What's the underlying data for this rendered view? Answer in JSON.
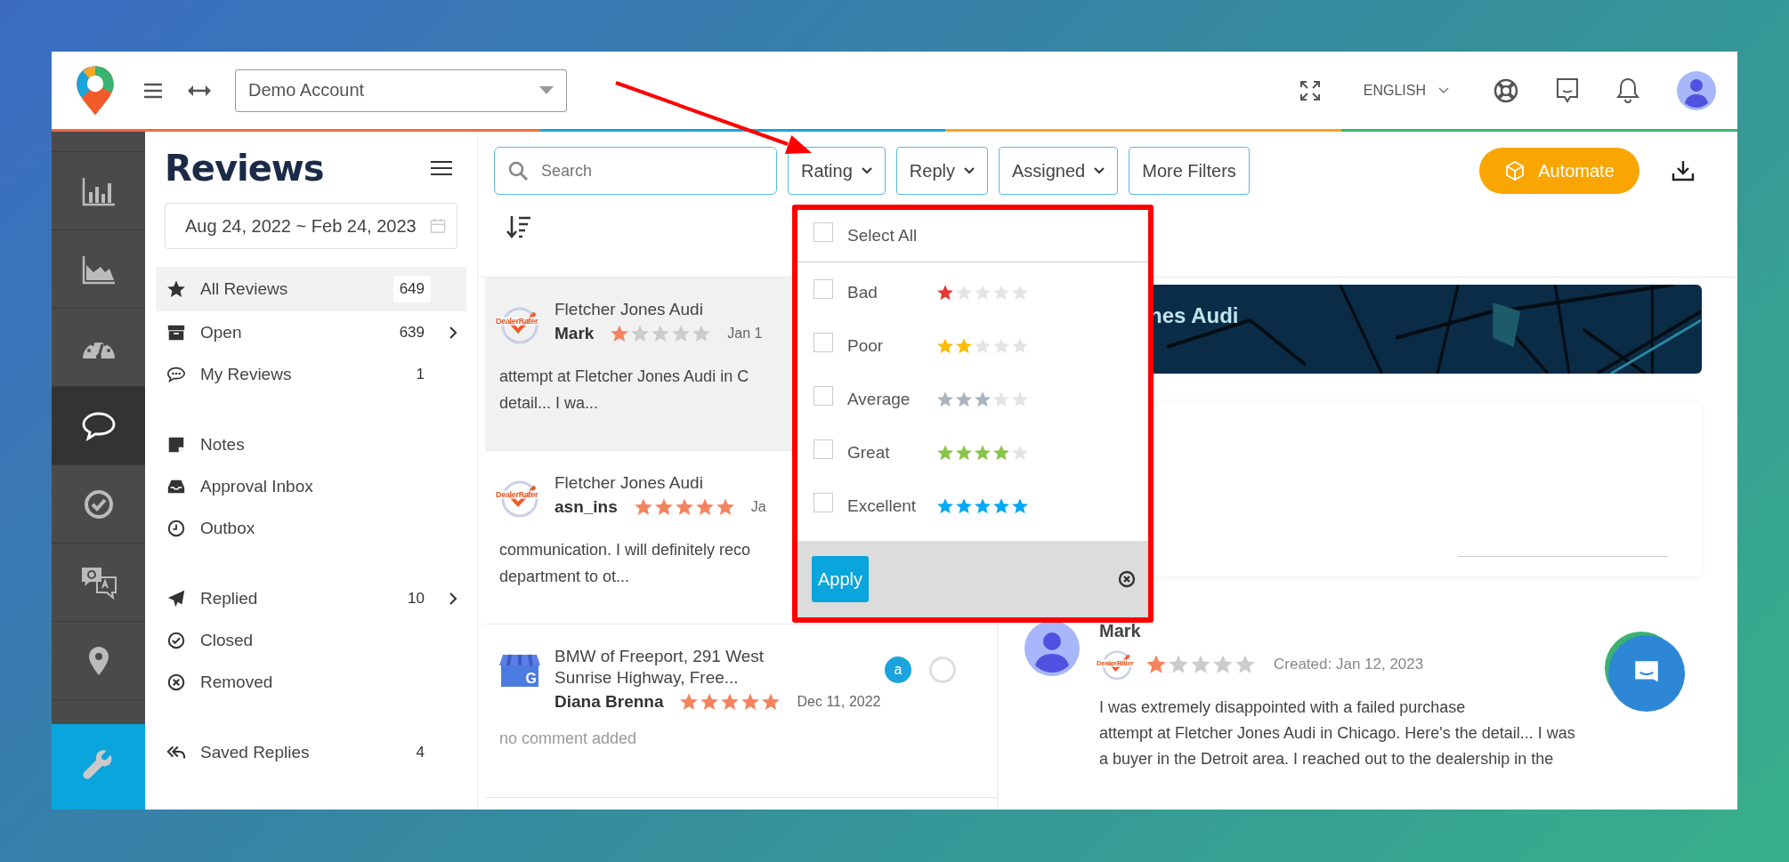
{
  "header": {
    "account": "Demo Account",
    "language": "ENGLISH"
  },
  "rail": [
    {
      "selected": false
    },
    {
      "selected": false
    },
    {
      "selected": false
    },
    {
      "selected": true
    },
    {
      "selected": false
    },
    {
      "selected": false
    },
    {
      "selected": false
    }
  ],
  "sidebar": {
    "title": "Reviews",
    "date_range": "Aug 24, 2022 ~ Feb 24, 2023",
    "groups": [
      [
        {
          "label": "All Reviews",
          "count": "649",
          "selected": true,
          "expandable": false
        },
        {
          "label": "Open",
          "count": "639",
          "selected": false,
          "expandable": true
        },
        {
          "label": "My Reviews",
          "count": "1",
          "selected": false,
          "expandable": false
        }
      ],
      [
        {
          "label": "Notes",
          "selected": false,
          "expandable": false
        },
        {
          "label": "Approval Inbox",
          "selected": false,
          "expandable": false
        },
        {
          "label": "Outbox",
          "selected": false,
          "expandable": false
        }
      ],
      [
        {
          "label": "Replied",
          "count": "10",
          "selected": false,
          "expandable": true
        },
        {
          "label": "Closed",
          "selected": false,
          "expandable": false
        },
        {
          "label": "Removed",
          "selected": false,
          "expandable": false
        }
      ],
      [
        {
          "label": "Saved Replies",
          "count": "4",
          "selected": false,
          "expandable": false
        }
      ]
    ]
  },
  "toolbar": {
    "search_placeholder": "Search",
    "filters": [
      "Rating",
      "Reply",
      "Assigned"
    ],
    "more_filters": "More Filters",
    "automate": "Automate"
  },
  "rating_menu": {
    "select_all": {
      "label": "Select All",
      "checked": false
    },
    "options": [
      {
        "label": "Bad",
        "stars": 1,
        "color": "#e53935",
        "checked": false
      },
      {
        "label": "Poor",
        "stars": 2,
        "color": "#fbbc05",
        "checked": false
      },
      {
        "label": "Average",
        "stars": 3,
        "color": "#aab4be",
        "checked": false
      },
      {
        "label": "Great",
        "stars": 4,
        "color": "#8bc34a",
        "checked": false
      },
      {
        "label": "Excellent",
        "stars": 5,
        "color": "#03a9f4",
        "checked": false
      }
    ],
    "apply": "Apply"
  },
  "reviews": [
    {
      "business": "Fletcher Jones Audi",
      "source": {
        "kind": "dealerrater",
        "label": "DealerRater"
      },
      "author": "Mark",
      "stars": 1,
      "date": "Jan 1",
      "excerpt": [
        "attempt at Fletcher Jones Audi in C",
        "detail... I wa..."
      ],
      "selected": true
    },
    {
      "business": "Fletcher Jones Audi",
      "source": {
        "kind": "dealerrater",
        "label": "DealerRater"
      },
      "author": "asn_ins",
      "stars": 5,
      "date": "Ja",
      "excerpt": [
        "communication. I will definitely reco",
        "department to ot..."
      ],
      "selected": false
    },
    {
      "business": "BMW of Freeport, 291 West Sunrise Highway, Free...",
      "source": {
        "kind": "google",
        "label": "G"
      },
      "author": "Diana Brenna",
      "stars": 5,
      "date": "Dec 11, 2022",
      "badge": "a",
      "checked": false,
      "note": "no comment added",
      "selected": false
    }
  ],
  "detail": {
    "banner_title": "nes Audi",
    "review": {
      "author": "Mark",
      "source": {
        "kind": "dealerrater",
        "label": "DealerRater"
      },
      "stars": 1,
      "created": "Created: Jan 12, 2023",
      "text": [
        "I was extremely disappointed with a failed purchase",
        "attempt at Fletcher Jones Audi in Chicago. Here's the detail... I was",
        "a buyer in the Detroit area. I reached out to the dealership in the"
      ]
    }
  }
}
